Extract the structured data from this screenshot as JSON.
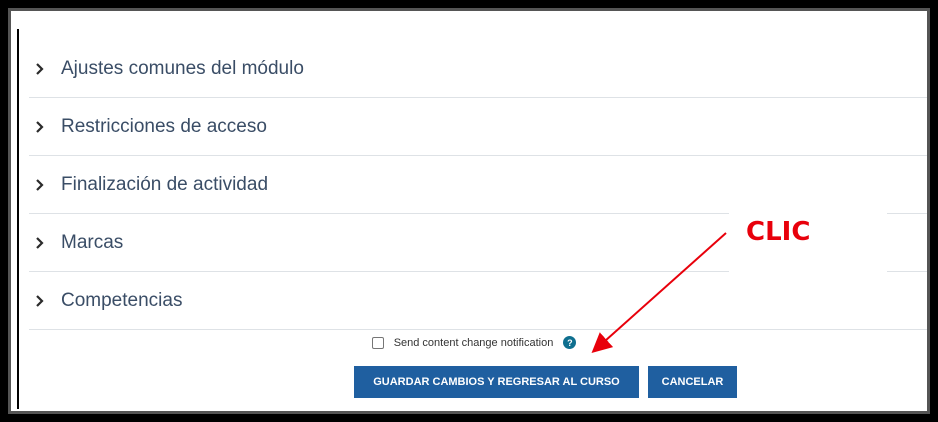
{
  "sections": [
    {
      "label": "Ajustes comunes del módulo"
    },
    {
      "label": "Restricciones de acceso"
    },
    {
      "label": "Finalización de actividad"
    },
    {
      "label": "Marcas"
    },
    {
      "label": "Competencias"
    }
  ],
  "notification": {
    "label": "Send content change notification",
    "checked": false,
    "help_icon": "question-circle-icon"
  },
  "buttons": {
    "save_label": "GUARDAR CAMBIOS Y REGRESAR AL CURSO",
    "cancel_label": "CANCELAR"
  },
  "annotation": {
    "label": "CLIC",
    "color": "#e8000b"
  },
  "colors": {
    "button_bg": "#1f5fa0",
    "section_text": "#3a4d66"
  }
}
